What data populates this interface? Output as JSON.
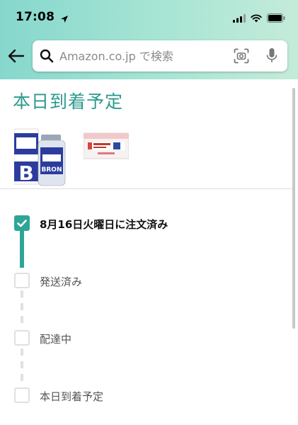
{
  "status_bar": {
    "time": "17:08"
  },
  "search": {
    "placeholder": "Amazon.co.jp で検索"
  },
  "page": {
    "title": "本日到着予定"
  },
  "products": [
    {
      "box_small_text": "エスエスブロン錠",
      "box_big": "BRON"
    },
    {
      "box_big": "レスタミンU",
      "box_sub": "コーワ"
    }
  ],
  "tracking": {
    "steps": [
      {
        "label": "8月16日火曜日に注文済み",
        "done": true
      },
      {
        "label": "発送済み",
        "done": false
      },
      {
        "label": "配達中",
        "done": false
      },
      {
        "label": "本日到着予定",
        "done": false
      }
    ]
  },
  "colors": {
    "accent": "#2ea597",
    "title": "#2a9a8d",
    "header_left": "#86d7cd",
    "header_right": "#c4ebda"
  }
}
